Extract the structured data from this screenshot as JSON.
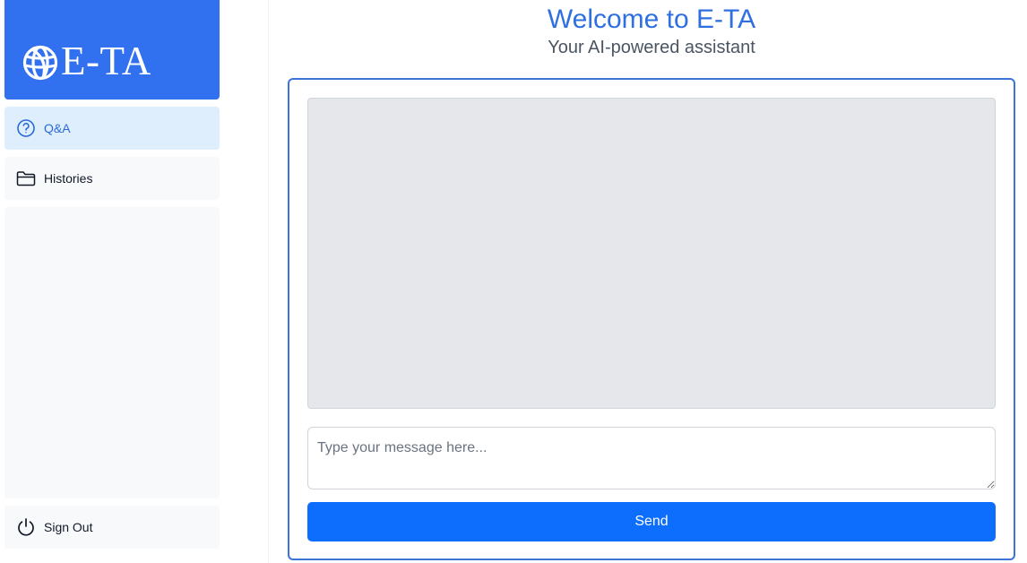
{
  "sidebar": {
    "logo": {
      "text": "E-TA",
      "icon": "globe-icon"
    },
    "items": [
      {
        "label": "Q&A",
        "icon": "question-circle-icon",
        "active": true
      },
      {
        "label": "Histories",
        "icon": "folder-icon",
        "active": false
      }
    ],
    "sign_out": {
      "label": "Sign Out",
      "icon": "power-icon"
    }
  },
  "header": {
    "title": "Welcome to E-TA",
    "subtitle": "Your AI-powered assistant"
  },
  "chat": {
    "messages": [],
    "input": {
      "value": "",
      "placeholder": "Type your message here..."
    },
    "send_label": "Send"
  },
  "colors": {
    "brand": "#3170ee",
    "accent": "#2f6fe0",
    "button": "#0d6efd",
    "active_nav_bg": "#dfeefc"
  }
}
